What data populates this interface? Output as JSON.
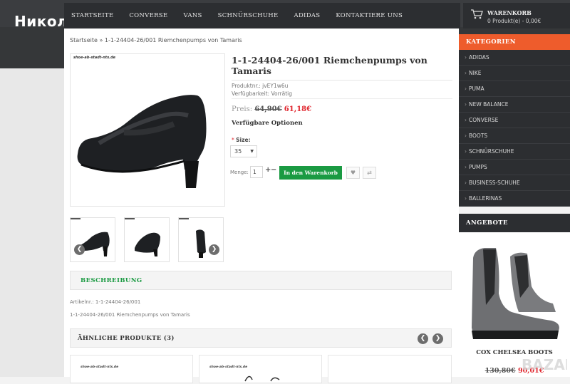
{
  "watermark": "Николай",
  "nav": {
    "items": [
      "Startseite",
      "Converse",
      "Vans",
      "Schnürschuhe",
      "Adidas",
      "Kontaktiere uns"
    ]
  },
  "cart": {
    "title": "WARENKORB",
    "summary": "0 Produkt(e) - 0,00€"
  },
  "breadcrumb": {
    "home": "Startseite",
    "separator": " » ",
    "current": "1-1-24404-26/001 Riemchenpumps von Tamaris"
  },
  "product": {
    "image_logo": "shoe-ab-stadt-nts.de",
    "title": "1-1-24404-26/001 Riemchenpumps von Tamaris",
    "product_no": "Produktnr.: jvEY1w6u",
    "availability": "Verfügbarkeit: Vorrätig",
    "price_label": "Preis:",
    "price_old": "64,90€",
    "price_new": "61,18€",
    "options_title": "Verfügbare Optionen",
    "size_label": "Size:",
    "size_required": "*",
    "size_value": "35",
    "qty_label": "Menge:",
    "qty_value": "1",
    "qty_plus": "+",
    "qty_minus": "−",
    "add_to_cart": "In den Warenkorb",
    "wishlist_icon": "heart-icon",
    "compare_icon": "compare-icon"
  },
  "description": {
    "title": "BESCHREIBUNG",
    "article_no": "Artikelnr.: 1-1-24404-26/001",
    "text": "1-1-24404-26/001 Riemchenpumps von Tamaris"
  },
  "similar": {
    "title": "ÄHNLICHE PRODUKTE (3)",
    "card_logo": "shoe-ab-stadt-nts.de"
  },
  "sidebar": {
    "categories_title": "KATEGORIEN",
    "categories": [
      "ADIDAS",
      "NIKE",
      "PUMA",
      "NEW BALANCE",
      "CONVERSE",
      "BOOTS",
      "SCHNÜRSCHUHE",
      "PUMPS",
      "BUSINESS-SCHUHE",
      "BALLERINAS"
    ],
    "offers_title": "ANGEBOTE",
    "offer_name": "COX CHELSEA BOOTS",
    "offer_old": "130,80€",
    "offer_new": "90,01€"
  },
  "colors": {
    "accent_orange": "#ee5c2c",
    "green": "#1a9a42",
    "price_red": "#e0242c",
    "dark": "#2c2e31"
  }
}
